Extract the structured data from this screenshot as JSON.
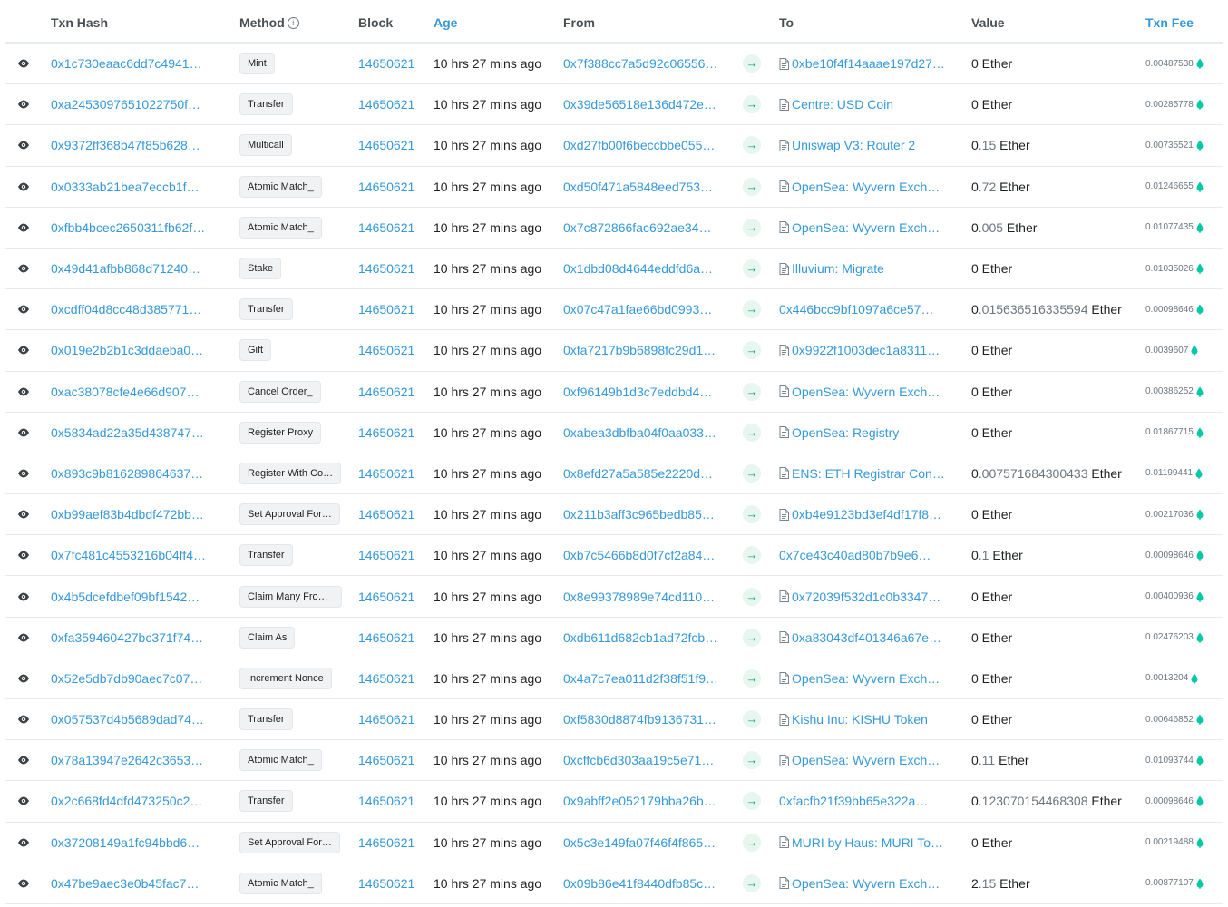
{
  "header": {
    "txn_hash": "Txn Hash",
    "method": "Method",
    "block": "Block",
    "age": "Age",
    "from": "From",
    "to": "To",
    "value": "Value",
    "txn_fee": "Txn Fee"
  },
  "rows": [
    {
      "hash": "0x1c730eaac6dd7c4941…",
      "method": "Mint",
      "block": "14650621",
      "age": "10 hrs 27 mins ago",
      "from": "0x7f388cc7a5d92c06556…",
      "to": "0xbe10f4f14aaae197d27…",
      "to_contract": true,
      "value_int": "0",
      "value_dec": "",
      "value_unit": " Ether",
      "fee": "0.00487538"
    },
    {
      "hash": "0xa2453097651022750f…",
      "method": "Transfer",
      "block": "14650621",
      "age": "10 hrs 27 mins ago",
      "from": "0x39de56518e136d472e…",
      "to": "Centre: USD Coin",
      "to_contract": true,
      "value_int": "0",
      "value_dec": "",
      "value_unit": " Ether",
      "fee": "0.00285778"
    },
    {
      "hash": "0x9372ff368b47f85b628…",
      "method": "Multicall",
      "block": "14650621",
      "age": "10 hrs 27 mins ago",
      "from": "0xd27fb00f6beccbbe055…",
      "to": "Uniswap V3: Router 2",
      "to_contract": true,
      "value_int": "0",
      "value_dec": ".15",
      "value_unit": " Ether",
      "fee": "0.00735521"
    },
    {
      "hash": "0x0333ab21bea7eccb1f…",
      "method": "Atomic Match_",
      "block": "14650621",
      "age": "10 hrs 27 mins ago",
      "from": "0xd50f471a5848eed753…",
      "to": "OpenSea: Wyvern Exch…",
      "to_contract": true,
      "value_int": "0",
      "value_dec": ".72",
      "value_unit": " Ether",
      "fee": "0.01246655"
    },
    {
      "hash": "0xfbb4bcec2650311fb62f…",
      "method": "Atomic Match_",
      "block": "14650621",
      "age": "10 hrs 27 mins ago",
      "from": "0x7c872866fac692ae34…",
      "to": "OpenSea: Wyvern Exch…",
      "to_contract": true,
      "value_int": "0",
      "value_dec": ".005",
      "value_unit": " Ether",
      "fee": "0.01077435"
    },
    {
      "hash": "0x49d41afbb868d71240…",
      "method": "Stake",
      "block": "14650621",
      "age": "10 hrs 27 mins ago",
      "from": "0x1dbd08d4644eddfd6a…",
      "to": "Illuvium: Migrate",
      "to_contract": true,
      "value_int": "0",
      "value_dec": "",
      "value_unit": " Ether",
      "fee": "0.01035026"
    },
    {
      "hash": "0xcdff04d8cc48d385771…",
      "method": "Transfer",
      "block": "14650621",
      "age": "10 hrs 27 mins ago",
      "from": "0x07c47a1fae66bd0993…",
      "to": "0x446bcc9bf1097a6ce57…",
      "to_contract": false,
      "value_int": "0",
      "value_dec": ".015636516335594",
      "value_unit": " Ether",
      "fee": "0.00098646"
    },
    {
      "hash": "0x019e2b2b1c3ddaeba0…",
      "method": "Gift",
      "block": "14650621",
      "age": "10 hrs 27 mins ago",
      "from": "0xfa7217b9b6898fc29d1…",
      "to": "0x9922f1003dec1a8311…",
      "to_contract": true,
      "value_int": "0",
      "value_dec": "",
      "value_unit": " Ether",
      "fee": "0.0039607"
    },
    {
      "hash": "0xac38078cfe4e66d907…",
      "method": "Cancel Order_",
      "block": "14650621",
      "age": "10 hrs 27 mins ago",
      "from": "0xf96149b1d3c7eddbd4…",
      "to": "OpenSea: Wyvern Exch…",
      "to_contract": true,
      "value_int": "0",
      "value_dec": "",
      "value_unit": " Ether",
      "fee": "0.00386252"
    },
    {
      "hash": "0x5834ad22a35d438747…",
      "method": "Register Proxy",
      "block": "14650621",
      "age": "10 hrs 27 mins ago",
      "from": "0xabea3dbfba04f0aa033…",
      "to": "OpenSea: Registry",
      "to_contract": true,
      "value_int": "0",
      "value_dec": "",
      "value_unit": " Ether",
      "fee": "0.01867715"
    },
    {
      "hash": "0x893c9b816289864637…",
      "method": "Register With Co…",
      "block": "14650621",
      "age": "10 hrs 27 mins ago",
      "from": "0x8efd27a5a585e2220d…",
      "to": "ENS: ETH Registrar Con…",
      "to_contract": true,
      "value_int": "0",
      "value_dec": ".007571684300433",
      "value_unit": " Ether",
      "fee": "0.01199441"
    },
    {
      "hash": "0xb99aef83b4dbdf472bb…",
      "method": "Set Approval For…",
      "block": "14650621",
      "age": "10 hrs 27 mins ago",
      "from": "0x211b3aff3c965bedb85…",
      "to": "0xb4e9123bd3ef4df17f8…",
      "to_contract": true,
      "value_int": "0",
      "value_dec": "",
      "value_unit": " Ether",
      "fee": "0.00217036"
    },
    {
      "hash": "0x7fc481c4553216b04ff4…",
      "method": "Transfer",
      "block": "14650621",
      "age": "10 hrs 27 mins ago",
      "from": "0xb7c5466b8d0f7cf2a84…",
      "to": "0x7ce43c40ad80b7b9e6…",
      "to_contract": false,
      "value_int": "0",
      "value_dec": ".1",
      "value_unit": " Ether",
      "fee": "0.00098646"
    },
    {
      "hash": "0x4b5dcefdbef09bf1542…",
      "method": "Claim Many From …",
      "block": "14650621",
      "age": "10 hrs 27 mins ago",
      "from": "0x8e99378989e74cd110…",
      "to": "0x72039f532d1c0b3347…",
      "to_contract": true,
      "value_int": "0",
      "value_dec": "",
      "value_unit": " Ether",
      "fee": "0.00400936"
    },
    {
      "hash": "0xfa359460427bc371f74…",
      "method": "Claim As",
      "block": "14650621",
      "age": "10 hrs 27 mins ago",
      "from": "0xdb611d682cb1ad72fcb…",
      "to": "0xa83043df401346a67e…",
      "to_contract": true,
      "value_int": "0",
      "value_dec": "",
      "value_unit": " Ether",
      "fee": "0.02476203"
    },
    {
      "hash": "0x52e5db7db90aec7c07…",
      "method": "Increment Nonce",
      "block": "14650621",
      "age": "10 hrs 27 mins ago",
      "from": "0x4a7c7ea011d2f38f51f9…",
      "to": "OpenSea: Wyvern Exch…",
      "to_contract": true,
      "value_int": "0",
      "value_dec": "",
      "value_unit": " Ether",
      "fee": "0.0013204"
    },
    {
      "hash": "0x057537d4b5689dad74…",
      "method": "Transfer",
      "block": "14650621",
      "age": "10 hrs 27 mins ago",
      "from": "0xf5830d8874fb9136731…",
      "to": "Kishu Inu: KISHU Token",
      "to_contract": true,
      "value_int": "0",
      "value_dec": "",
      "value_unit": " Ether",
      "fee": "0.00646852"
    },
    {
      "hash": "0x78a13947e2642c3653…",
      "method": "Atomic Match_",
      "block": "14650621",
      "age": "10 hrs 27 mins ago",
      "from": "0xcffcb6d303aa19c5e71…",
      "to": "OpenSea: Wyvern Exch…",
      "to_contract": true,
      "value_int": "0",
      "value_dec": ".11",
      "value_unit": " Ether",
      "fee": "0.01093744"
    },
    {
      "hash": "0x2c668fd4dfd473250c2…",
      "method": "Transfer",
      "block": "14650621",
      "age": "10 hrs 27 mins ago",
      "from": "0x9abff2e052179bba26b…",
      "to": "0xfacfb21f39bb65e322a…",
      "to_contract": false,
      "value_int": "0",
      "value_dec": ".123070154468308",
      "value_unit": " Ether",
      "fee": "0.00098646"
    },
    {
      "hash": "0x37208149a1fc94bbd6…",
      "method": "Set Approval For…",
      "block": "14650621",
      "age": "10 hrs 27 mins ago",
      "from": "0x5c3e149fa07f46f4f865…",
      "to": "MURI by Haus: MURI To…",
      "to_contract": true,
      "value_int": "0",
      "value_dec": "",
      "value_unit": " Ether",
      "fee": "0.00219488"
    },
    {
      "hash": "0x47be9aec3e0b45fac7…",
      "method": "Atomic Match_",
      "block": "14650621",
      "age": "10 hrs 27 mins ago",
      "from": "0x09b86e41f8440dfb85c…",
      "to": "OpenSea: Wyvern Exch…",
      "to_contract": true,
      "value_int": "2",
      "value_dec": ".15",
      "value_unit": " Ether",
      "fee": "0.00877107"
    }
  ],
  "icons": {
    "view": "eye-icon",
    "direction": "arrow-right-icon",
    "contract": "document-icon",
    "gas": "gas-drop-icon",
    "info": "info-icon"
  },
  "colors": {
    "link": "#3498db",
    "arrow_bg": "#e7f6ee",
    "arrow": "#00a186",
    "gas": "#00c9a7"
  }
}
